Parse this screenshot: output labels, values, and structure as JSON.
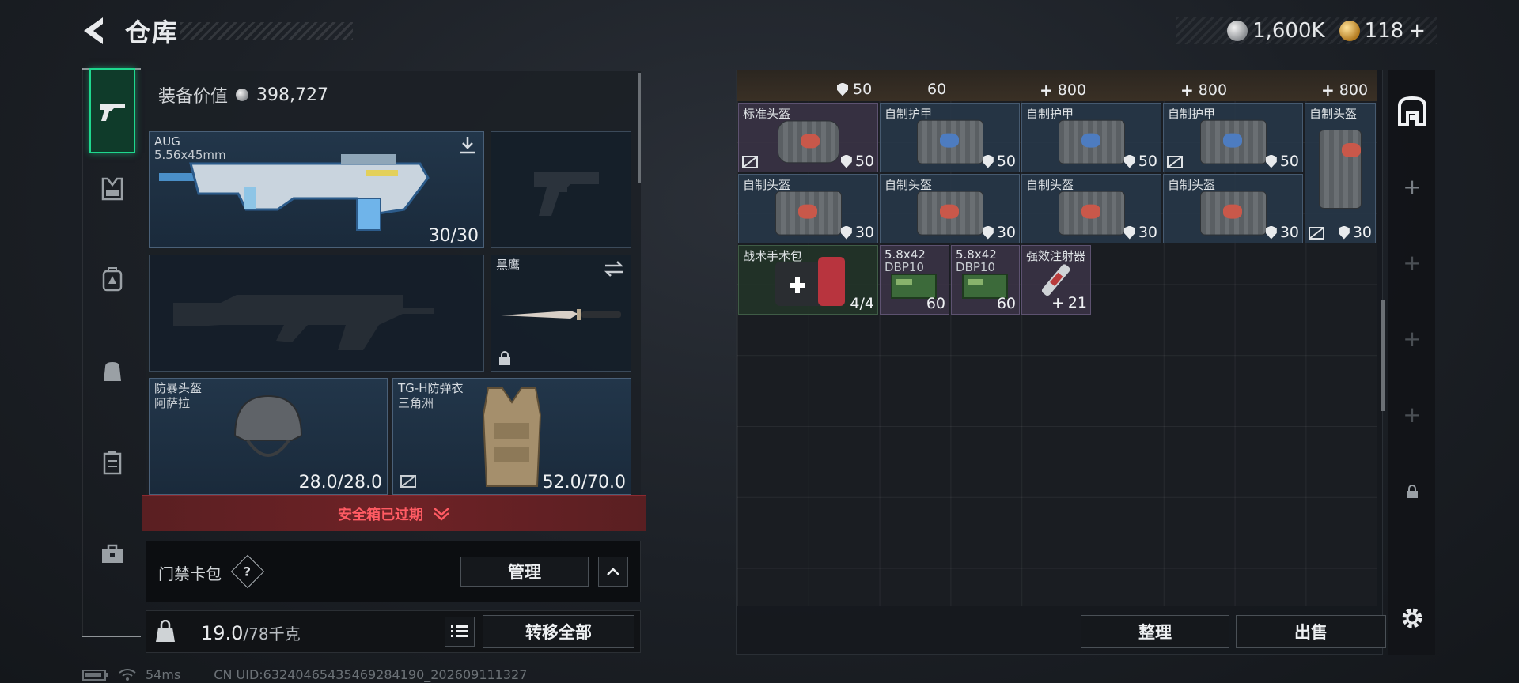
{
  "header": {
    "title": "仓库",
    "currency": [
      {
        "name": "silver-coin",
        "amount": "1,600K",
        "color": "#b8bcc0"
      },
      {
        "name": "gold-coin",
        "amount": "118",
        "suffix": "+",
        "color": "#d8a23c"
      }
    ]
  },
  "loadout": {
    "value_label": "装备价值",
    "value": "398,727",
    "primary_weapon": {
      "name": "AUG",
      "caliber": "5.56x45mm",
      "ammo": "30/30"
    },
    "melee": {
      "name": "黑鹰"
    },
    "helmet": {
      "name": "防暴头盔",
      "source": "阿萨拉",
      "durability": "28.0/28.0"
    },
    "armor": {
      "name": "TG-H防弹衣",
      "source": "三角洲",
      "durability": "52.0/70.0"
    },
    "safebox_status": "安全箱已过期",
    "keycard_label": "门禁卡包",
    "keycard_help": "?",
    "manage_label": "管理",
    "weight": "19.0",
    "weight_max": "/78千克",
    "transfer_all_label": "转移全部"
  },
  "status_bar": {
    "ping": "54ms",
    "uid": "CN UID:632404654354692841​90_202609111327"
  },
  "storage": {
    "top_row_values": [
      "50",
      "60",
      "800",
      "800",
      "800"
    ],
    "items": [
      {
        "title": "标准头盔",
        "value": "50",
        "type": "helmet",
        "no_trade": true
      },
      {
        "title": "自制护甲",
        "value": "50",
        "type": "armor",
        "no_trade": false
      },
      {
        "title": "自制护甲",
        "value": "50",
        "type": "armor",
        "no_trade": false
      },
      {
        "title": "自制护甲",
        "value": "50",
        "type": "armor",
        "no_trade": true
      },
      {
        "title": "自制头盔",
        "value": "30",
        "type": "helmet",
        "no_trade": true
      },
      {
        "title": "自制头盔",
        "value": "30",
        "type": "helmet",
        "no_trade": false
      },
      {
        "title": "自制头盔",
        "value": "30",
        "type": "helmet",
        "no_trade": false
      },
      {
        "title": "自制头盔",
        "value": "30",
        "type": "helmet",
        "no_trade": false
      },
      {
        "title": "自制头盔",
        "value": "30",
        "type": "helmet",
        "no_trade": false
      },
      {
        "title": "战术手术包",
        "value": "4/4",
        "type": "medkit"
      },
      {
        "title": "5.8x42",
        "subtitle": "DBP10",
        "value": "60",
        "type": "ammo"
      },
      {
        "title": "5.8x42",
        "subtitle": "DBP10",
        "value": "60",
        "type": "ammo"
      },
      {
        "title": "强效注射器",
        "value": "21",
        "type": "injector"
      }
    ],
    "sort_label": "整理",
    "sell_label": "出售"
  }
}
